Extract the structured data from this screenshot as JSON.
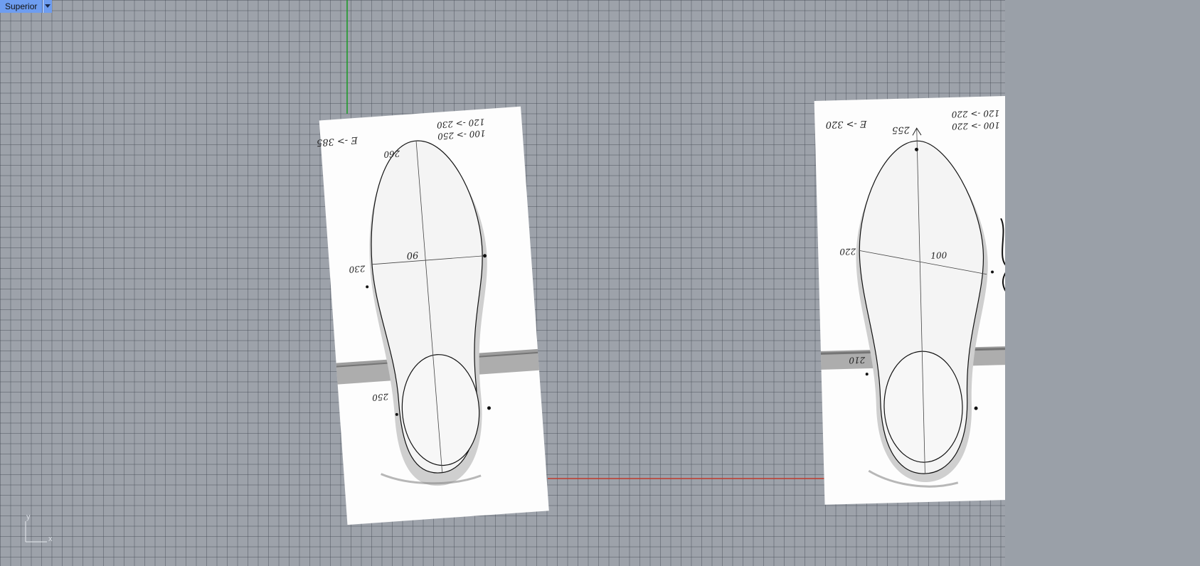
{
  "viewport": {
    "name": "Superior",
    "dropdown_icon": "triangle-down-icon"
  },
  "axis_widget": {
    "y": "y",
    "x": "x"
  },
  "colors": {
    "y_axis": "#1e9a2a",
    "x_axis": "#c0392b",
    "tab": "#6e9df0",
    "grid": "#9da2aa"
  },
  "left_sheet": {
    "notes": {
      "top_left": "E -> 385",
      "top_right_1": "120 -> 230",
      "top_right_2": "100 -> 250",
      "toe": "260",
      "ball": "230",
      "center": "90",
      "heel": "250"
    }
  },
  "right_sheet": {
    "notes": {
      "top_left": "E -> 320",
      "top_right_1": "120 -> 220",
      "top_right_2": "100 -> 220",
      "toe": "255",
      "ball": "220",
      "center": "100",
      "heel": "210"
    }
  }
}
